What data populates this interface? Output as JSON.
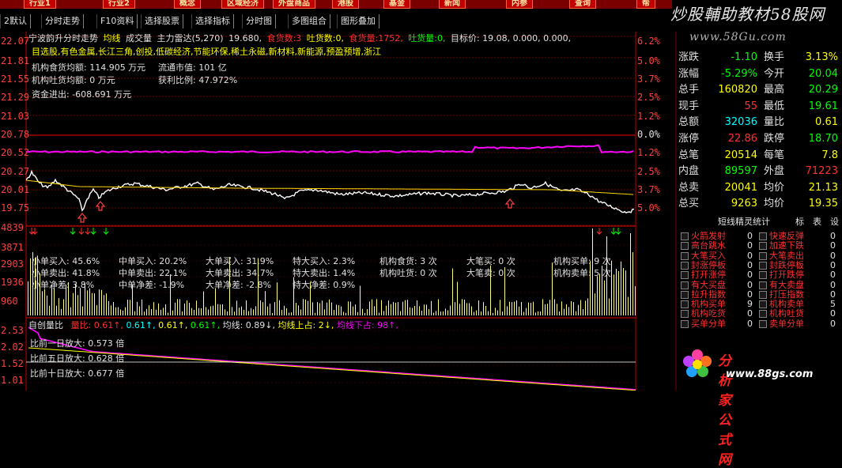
{
  "nav": [
    "行业1",
    "行业2",
    "概念",
    "区域经济",
    "外盘商品",
    "港股",
    "基金",
    "新闻",
    "内参",
    "查询",
    "帮"
  ],
  "tabs": [
    "2默认",
    "分时走势",
    "F10资料",
    "选择股票",
    "选择指标",
    "分时图",
    "多图组合",
    "图形叠加"
  ],
  "watermark": {
    "title": "炒股輔助教材58股网",
    "url": "www.58Gu.com"
  },
  "header": {
    "name": "宁波韵升分时走势",
    "line1": "均线",
    "line2": "成交量",
    "line3": "主力雷达(5,270)",
    "price": "19.680,",
    "eat_label": "食货数:",
    "eat_val": "3",
    "spit_label": "吐货数:",
    "spit_val": "0,",
    "eat_qty_label": "食货量:",
    "eat_qty_val": "1752,",
    "spit_qty_label": "吐货量:",
    "spit_qty_val": "0,",
    "target_label": "目标价:",
    "target_vals": "19.08, 0.000, 0.000,"
  },
  "concepts": "目选股,有色金属,长江三角,创投,低碳经济,节能环保,稀土永磁,新材料,新能源,预盈预增,浙江",
  "inst": {
    "eat_amt": "机构食货均额: 114.905 万元",
    "float_val": "流通市值: 101 亿",
    "spit_amt": "机构吐货均额: 0 万元",
    "profit": "获利比例: 47.972%",
    "fund_flow": "资金进出: -608.691 万元"
  },
  "price_axis": [
    "22.07",
    "21.81",
    "21.55",
    "21.29",
    "21.03",
    "20.78",
    "20.52",
    "20.27",
    "20.01",
    "19.75"
  ],
  "pct_axis": [
    "6.2%",
    "5.0%",
    "3.7%",
    "2.5%",
    "1.2%",
    "0.0%",
    "1.2%",
    "2.5%",
    "3.7%",
    "5.0%"
  ],
  "vol_axis": [
    "4839",
    "3871",
    "2903",
    "1936",
    "960"
  ],
  "ratio_axis": [
    "2.53",
    "2.02",
    "1.52",
    "1.01"
  ],
  "stats": {
    "r1": [
      "小单买入: 45.6%",
      "中单买入: 20.2%",
      "大单买入: 31.9%",
      "特大买入: 2.3%",
      "机构食货: 3 次",
      "大笔买: 0 次",
      "机构买单: 9 次"
    ],
    "r2": [
      "小单卖出: 41.8%",
      "中单卖出: 22.1%",
      "大单卖出: 34.7%",
      "特大卖出: 1.4%",
      "机构吐货: 0 次",
      "大笔卖: 0 次",
      "机构卖单: 5 次"
    ],
    "r3": [
      "小单净差: 3.8%",
      "中单净差: -1.9%",
      "大单净差: -2.8%",
      "特大净差: 0.9%"
    ]
  },
  "ratio_header": {
    "label": "自创量比",
    "lb": "量比:",
    "v1": "0.61↑,",
    "v2": "0.61↑,",
    "v3": "0.61↑,",
    "v4": "0.61↑,",
    "avg": "均线: 0.89↓,",
    "up": "均线上占: 2↓,",
    "down": "均线下占: 98↑,"
  },
  "ratio_lines": [
    "比前一日放大: 0.573 倍",
    "比前五日放大: 0.628 倍",
    "比前十日放大: 0.677 倍"
  ],
  "quote": [
    {
      "l1": "涨跌",
      "v1": "-1.10",
      "l2": "换手",
      "v2": "3.13%",
      "c1": "#00ff00",
      "c2": "#ffff00"
    },
    {
      "l1": "涨幅",
      "v1": "-5.29%",
      "l2": "今开",
      "v2": "20.04",
      "c1": "#00ff00",
      "c2": "#00ff00"
    },
    {
      "l1": "总手",
      "v1": "160820",
      "l2": "最高",
      "v2": "20.29",
      "c1": "#ffff00",
      "c2": "#00ff00"
    },
    {
      "l1": "现手",
      "v1": "55",
      "l2": "最低",
      "v2": "19.61",
      "c1": "#ff3030",
      "c2": "#00ff00"
    },
    {
      "l1": "总额",
      "v1": "32036",
      "l2": "量比",
      "v2": "0.61",
      "c1": "#00ffff",
      "c2": "#ffff00"
    },
    {
      "l1": "涨停",
      "v1": "22.86",
      "l2": "跌停",
      "v2": "18.70",
      "c1": "#ff3030",
      "c2": "#00ff00"
    },
    {
      "l1": "总笔",
      "v1": "20514",
      "l2": "每笔",
      "v2": "7.8",
      "c1": "#ffff00",
      "c2": "#ffff00"
    },
    {
      "l1": "内盘",
      "v1": "89597",
      "l2": "外盘",
      "v2": "71223",
      "c1": "#00ff00",
      "c2": "#ff3030"
    },
    {
      "l1": "总卖",
      "v1": "20041",
      "l2": "均价",
      "v2": "21.13",
      "c1": "#ffff00",
      "c2": "#ffff00"
    },
    {
      "l1": "总买",
      "v1": "9263",
      "l2": "均价",
      "v2": "19.35",
      "c1": "#ffff00",
      "c2": "#ffff00"
    }
  ],
  "jl_header": {
    "title": "短线精灵统计",
    "b1": "标",
    "b2": "表",
    "b3": "设"
  },
  "jl_left": [
    {
      "name": "火箭发射",
      "val": "0"
    },
    {
      "name": "高台跳水",
      "val": "0"
    },
    {
      "name": "大笔买入",
      "val": "0"
    },
    {
      "name": "封涨停板",
      "val": "0"
    },
    {
      "name": "打开涨停",
      "val": "0"
    },
    {
      "name": "有大买盘",
      "val": "0"
    },
    {
      "name": "拉升指数",
      "val": "0"
    },
    {
      "name": "机构买单",
      "val": "9"
    },
    {
      "name": "机构吃货",
      "val": "0"
    },
    {
      "name": "买单分单",
      "val": "0"
    }
  ],
  "jl_right": [
    {
      "name": "快速反弹",
      "val": "0"
    },
    {
      "name": "加速下跌",
      "val": "0"
    },
    {
      "name": "大笔卖出",
      "val": "0"
    },
    {
      "name": "封跌停板",
      "val": "0"
    },
    {
      "name": "打开跌停",
      "val": "0"
    },
    {
      "name": "有大卖盘",
      "val": "0"
    },
    {
      "name": "打压指数",
      "val": "0"
    },
    {
      "name": "机构卖单",
      "val": "5"
    },
    {
      "name": "机构吐货",
      "val": "0"
    },
    {
      "name": "卖单分单",
      "val": "0"
    }
  ],
  "logo": {
    "text": "分析家公式网",
    "url": "www.88gs.com"
  },
  "colors": {
    "price_line": "#ffffff",
    "avg_line": "#ffd700",
    "pink_line": "#ff00ff",
    "grid": "#8b0000",
    "volume": "#ffff80"
  }
}
